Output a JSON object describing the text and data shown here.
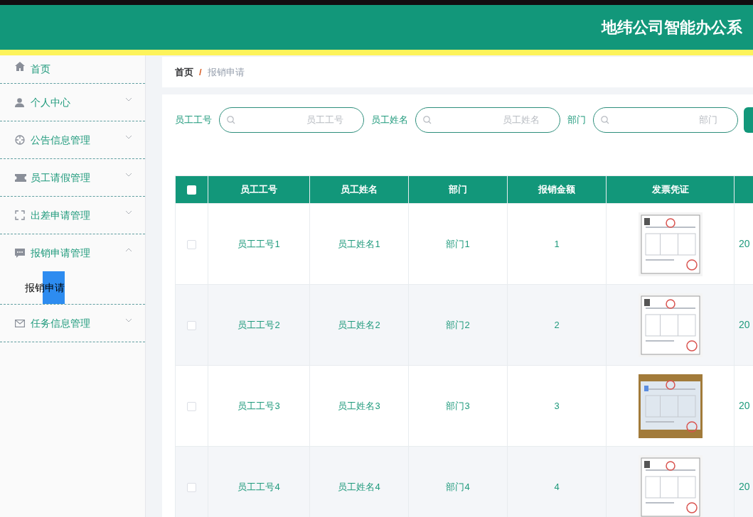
{
  "header": {
    "title": "地纬公司智能办公系"
  },
  "sidebar": {
    "items": [
      {
        "kind": "link",
        "label": "首页"
      },
      {
        "kind": "menu",
        "label": "个人中心",
        "expanded": false
      },
      {
        "kind": "menu",
        "label": "公告信息管理",
        "expanded": false
      },
      {
        "kind": "menu",
        "label": "员工请假管理",
        "expanded": false
      },
      {
        "kind": "menu",
        "label": "出差申请管理",
        "expanded": false
      },
      {
        "kind": "menu",
        "label": "报销申请管理",
        "expanded": true,
        "children": [
          {
            "label": "报销申请",
            "selected": true
          }
        ]
      },
      {
        "kind": "menu",
        "label": "任务信息管理",
        "expanded": false
      }
    ]
  },
  "breadcrumb": {
    "items": [
      "首页",
      "报销申请"
    ],
    "separator": "/"
  },
  "search": {
    "fields": [
      {
        "label": "员工工号",
        "placeholder": "员工工号"
      },
      {
        "label": "员工姓名",
        "placeholder": "员工姓名"
      },
      {
        "label": "部门",
        "placeholder": "部门"
      }
    ]
  },
  "table": {
    "select_all": {
      "checked": false
    },
    "columns": [
      "员工工号",
      "员工姓名",
      "部门",
      "报销金额",
      "发票凭证"
    ],
    "rows": [
      {
        "checked": false,
        "cells": [
          "员工工号1",
          "员工姓名1",
          "部门1",
          "1"
        ],
        "column_7": "20"
      },
      {
        "checked": false,
        "cells": [
          "员工工号2",
          "员工姓名2",
          "部门2",
          "2"
        ],
        "column_7": "20"
      },
      {
        "checked": false,
        "cells": [
          "员工工号3",
          "员工姓名3",
          "部门3",
          "3"
        ],
        "column_7": "20"
      },
      {
        "checked": false,
        "cells": [
          "员工工号4",
          "员工姓名4",
          "部门4",
          "4"
        ],
        "column_7": "20"
      }
    ]
  }
}
